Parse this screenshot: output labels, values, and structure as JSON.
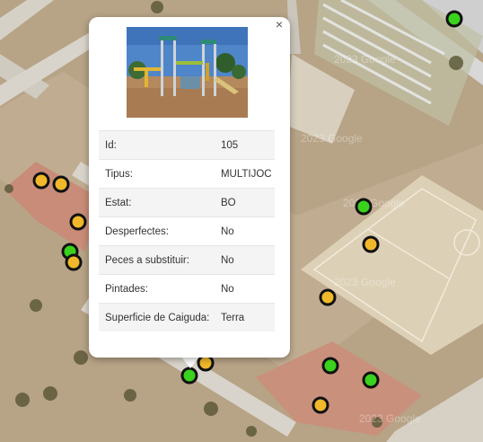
{
  "popup": {
    "close_label": "×",
    "photo_name": "playground-photo",
    "attributes": [
      {
        "label": "Id:",
        "value": "105"
      },
      {
        "label": "Tipus:",
        "value": "MULTIJOC"
      },
      {
        "label": "Estat:",
        "value": "BO"
      },
      {
        "label": "Desperfectes:",
        "value": "No"
      },
      {
        "label": "Peces a substituir:",
        "value": "No"
      },
      {
        "label": "Pintades:",
        "value": "No"
      },
      {
        "label": "Superficie de Caiguda:",
        "value": "Terra"
      }
    ]
  },
  "marker_colors": {
    "green": "#3ad21c",
    "yellow": "#f0b82a"
  },
  "map_labels": [
    "2023 Google",
    "2023 Google",
    "2023 Google",
    "2023 Google",
    "2023 Google"
  ]
}
